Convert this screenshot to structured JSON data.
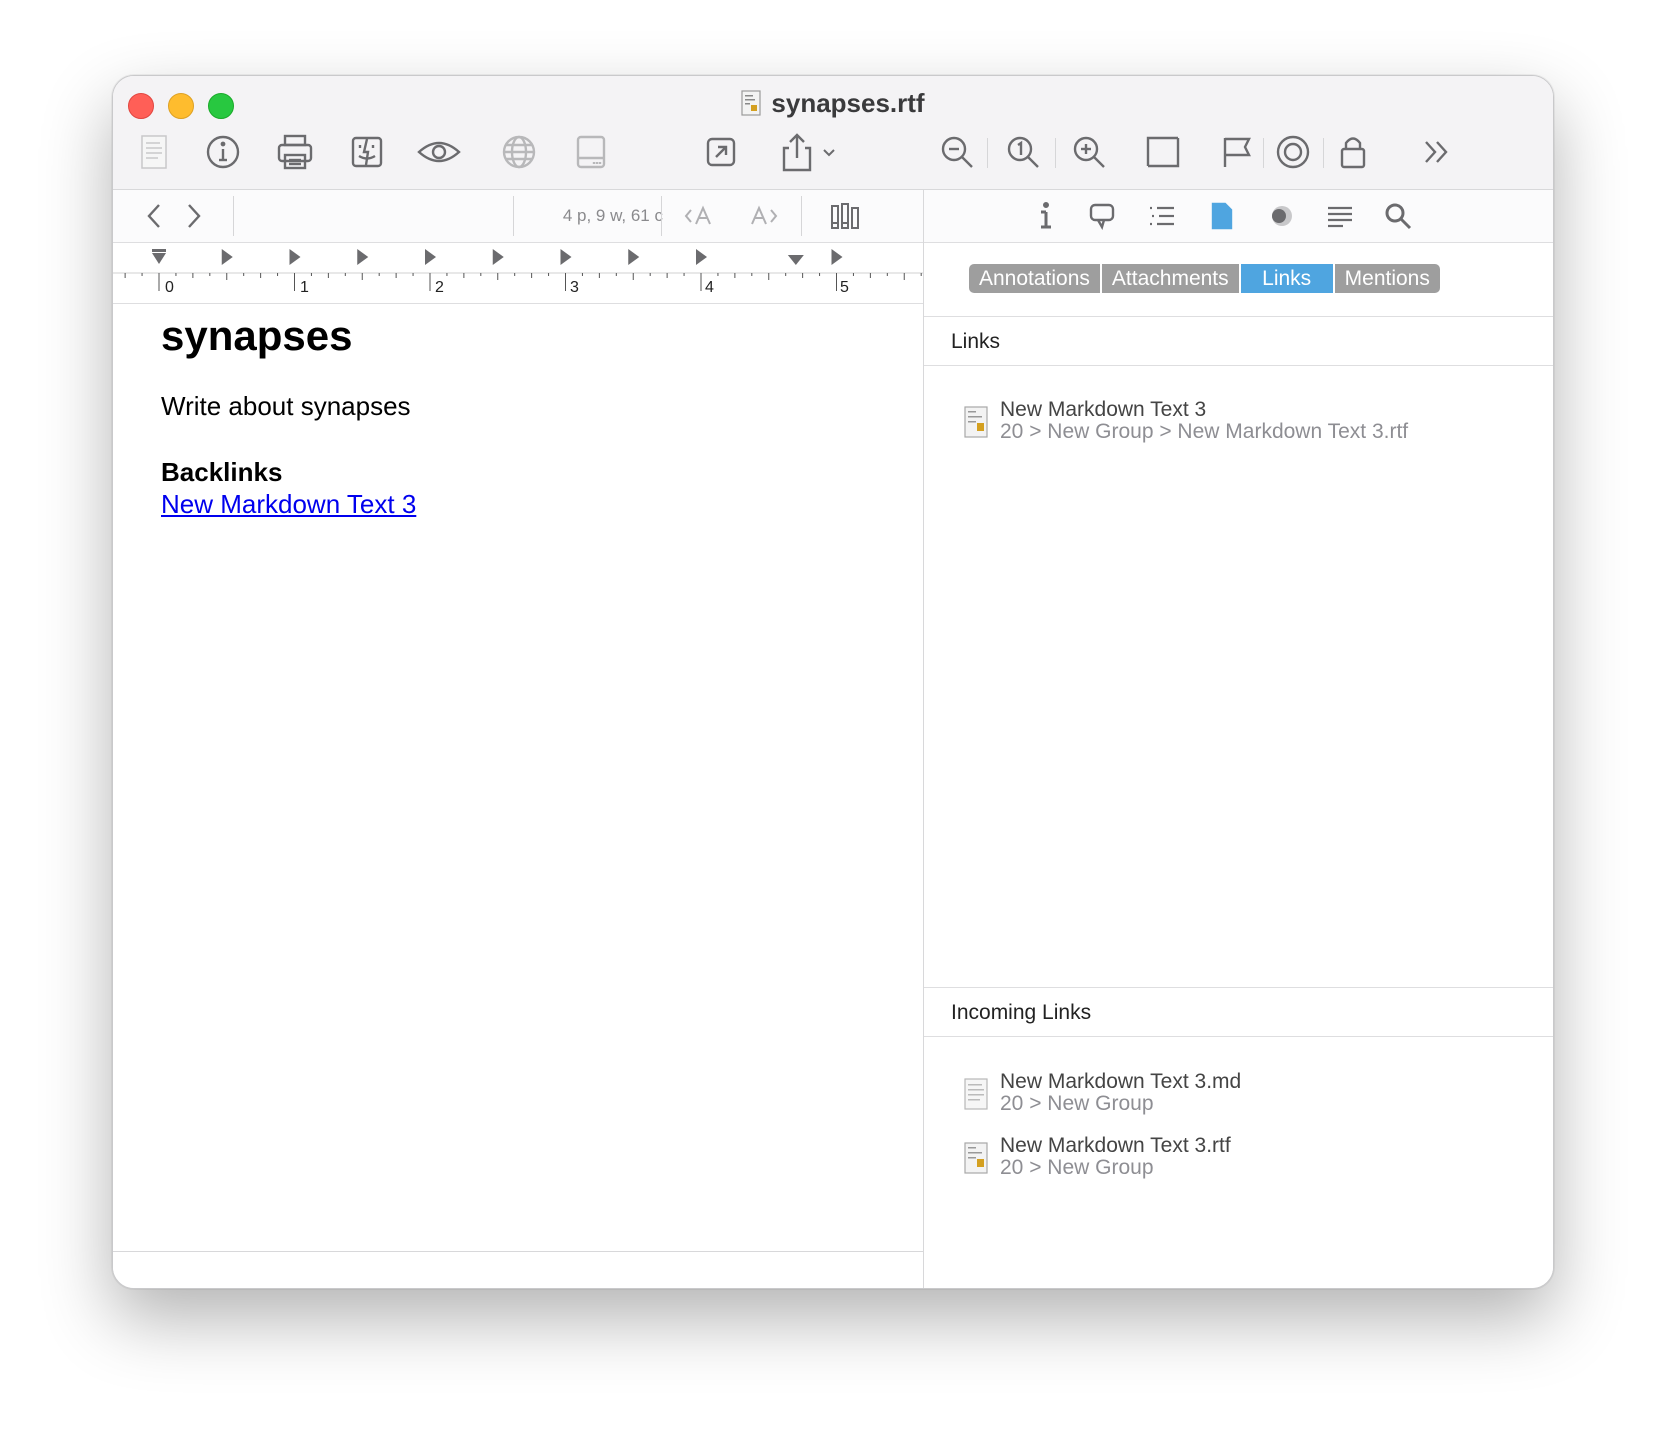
{
  "window": {
    "title": "synapses.rtf"
  },
  "toolbar": {
    "icons": [
      "document-icon",
      "info-icon",
      "print-icon",
      "finder-icon",
      "eye-icon",
      "globe-icon",
      "storage-icon",
      "open-external-icon",
      "share-icon",
      "zoom-out-icon",
      "actual-size-icon",
      "zoom-in-icon",
      "fit-icon",
      "flag-icon",
      "target-icon",
      "lock-icon",
      "more-icon"
    ]
  },
  "editor": {
    "stats": "4 p, 9 w, 61 c",
    "ruler_labels": [
      "0",
      "1",
      "2",
      "3",
      "4",
      "5"
    ],
    "doc_title": "synapses",
    "body": "Write about synapses",
    "backlinks_heading": "Backlinks",
    "backlink": "New Markdown Text 3"
  },
  "inspector": {
    "tabs": [
      {
        "label": "Annotations",
        "active": false
      },
      {
        "label": "Attachments",
        "active": false
      },
      {
        "label": "Links",
        "active": true
      },
      {
        "label": "Mentions",
        "active": false
      }
    ],
    "links_header": "Links",
    "links": [
      {
        "title": "New Markdown Text 3",
        "path": "20 > New Group > New Markdown Text 3.rtf"
      }
    ],
    "incoming_header": "Incoming Links",
    "incoming": [
      {
        "title": "New Markdown Text 3.md",
        "path": "20 > New Group"
      },
      {
        "title": "New Markdown Text 3.rtf",
        "path": "20 > New Group"
      }
    ]
  },
  "colors": {
    "accent": "#4fa5e0",
    "segment_inactive": "#9e9e9e",
    "link": "#0000ee"
  }
}
